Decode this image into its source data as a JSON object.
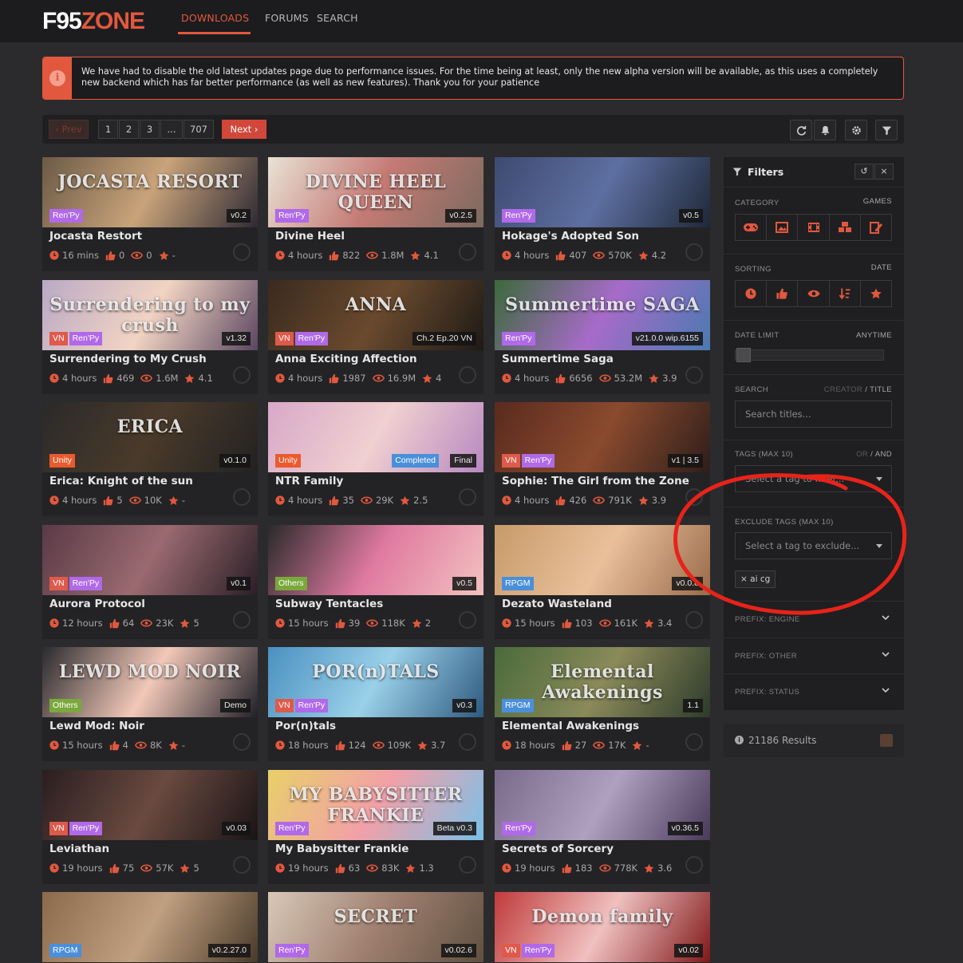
{
  "nav": {
    "logo_a": "F95",
    "logo_b": "ZONE",
    "items": [
      "DOWNLOADS",
      "FORUMS",
      "SEARCH"
    ]
  },
  "notice": {
    "icon": "info-icon",
    "text": "We have had to disable the old latest updates page due to performance issues. For the time being at least, only the new alpha version will be available, as this uses a completely new backend which has far better performance (as well as new features). Thank you for your patience"
  },
  "pager": {
    "prev": "‹ Prev",
    "pages": [
      "1",
      "2",
      "3",
      "...",
      "707"
    ],
    "next": "Next ›"
  },
  "cards": [
    {
      "title": "Jocasta Restort",
      "thumb_text": "JOCASTA RESORT",
      "badges": [
        "Ren'Py"
      ],
      "version": "v0.2",
      "time": "16 mins",
      "likes": "0",
      "views": "0",
      "rating": "-"
    },
    {
      "title": "Divine Heel",
      "thumb_text": "DIVINE HEEL QUEEN",
      "badges": [
        "Ren'Py"
      ],
      "version": "v0.2.5",
      "time": "4 hours",
      "likes": "822",
      "views": "1.8M",
      "rating": "4.1"
    },
    {
      "title": "Hokage's Adopted Son",
      "thumb_text": "",
      "badges": [
        "Ren'Py"
      ],
      "version": "v0.5",
      "time": "4 hours",
      "likes": "407",
      "views": "570K",
      "rating": "4.2"
    },
    {
      "title": "Surrendering to My Crush",
      "thumb_text": "Surrendering to my crush",
      "badges": [
        "VN",
        "Ren'Py"
      ],
      "version": "v1.32",
      "time": "4 hours",
      "likes": "469",
      "views": "1.6M",
      "rating": "4.1"
    },
    {
      "title": "Anna Exciting Affection",
      "thumb_text": "ANNA",
      "badges": [
        "VN",
        "Ren'Py"
      ],
      "version": "Ch.2 Ep.20 VN",
      "time": "4 hours",
      "likes": "1987",
      "views": "16.9M",
      "rating": "4"
    },
    {
      "title": "Summertime Saga",
      "thumb_text": "Summertime SAGA",
      "badges": [
        "Ren'Py"
      ],
      "version": "v21.0.0 wip.6155",
      "time": "4 hours",
      "likes": "6656",
      "views": "53.2M",
      "rating": "3.9"
    },
    {
      "title": "Erica: Knight of the sun",
      "thumb_text": "ERICA",
      "badges": [
        "Unity"
      ],
      "version": "v0.1.0",
      "time": "4 hours",
      "likes": "5",
      "views": "10K",
      "rating": "-"
    },
    {
      "title": "NTR Family",
      "thumb_text": "",
      "badges": [
        "Unity"
      ],
      "status": "Completed",
      "version": "Final",
      "time": "4 hours",
      "likes": "35",
      "views": "29K",
      "rating": "2.5"
    },
    {
      "title": "Sophie: The Girl from the Zone",
      "thumb_text": "",
      "badges": [
        "VN",
        "Ren'Py"
      ],
      "version": "v1 | 3.5",
      "time": "4 hours",
      "likes": "426",
      "views": "791K",
      "rating": "3.9"
    },
    {
      "title": "Aurora Protocol",
      "thumb_text": "",
      "badges": [
        "VN",
        "Ren'Py"
      ],
      "version": "v0.1",
      "time": "12 hours",
      "likes": "64",
      "views": "23K",
      "rating": "5"
    },
    {
      "title": "Subway Tentacles",
      "thumb_text": "",
      "badges": [
        "Others"
      ],
      "version": "v0.5",
      "time": "15 hours",
      "likes": "39",
      "views": "118K",
      "rating": "2"
    },
    {
      "title": "Dezato Wasteland",
      "thumb_text": "",
      "badges": [
        "RPGM"
      ],
      "version": "v0.0.8",
      "time": "15 hours",
      "likes": "103",
      "views": "161K",
      "rating": "3.4"
    },
    {
      "title": "Lewd Mod: Noir",
      "thumb_text": "LEWD MOD NOIR",
      "badges": [
        "Others"
      ],
      "version": "Demo",
      "time": "15 hours",
      "likes": "4",
      "views": "8K",
      "rating": "-"
    },
    {
      "title": "Por(n)tals",
      "thumb_text": "POR(n)TALS",
      "badges": [
        "VN",
        "Ren'Py"
      ],
      "version": "v0.3",
      "time": "18 hours",
      "likes": "124",
      "views": "109K",
      "rating": "3.7"
    },
    {
      "title": "Elemental Awakenings",
      "thumb_text": "Elemental Awakenings",
      "badges": [
        "RPGM"
      ],
      "version": "1.1",
      "time": "18 hours",
      "likes": "27",
      "views": "17K",
      "rating": "-"
    },
    {
      "title": "Leviathan",
      "thumb_text": "",
      "badges": [
        "VN",
        "Ren'Py"
      ],
      "version": "v0.03",
      "time": "19 hours",
      "likes": "75",
      "views": "57K",
      "rating": "5"
    },
    {
      "title": "My Babysitter Frankie",
      "thumb_text": "MY BABYSITTER FRANKIE",
      "badges": [
        "Ren'Py"
      ],
      "version": "Beta v0.3",
      "time": "19 hours",
      "likes": "63",
      "views": "83K",
      "rating": "1.3"
    },
    {
      "title": "Secrets of Sorcery",
      "thumb_text": "",
      "badges": [
        "Ren'Py"
      ],
      "version": "v0.36.5",
      "time": "19 hours",
      "likes": "183",
      "views": "778K",
      "rating": "3.6"
    },
    {
      "title": "",
      "thumb_text": "",
      "badges": [
        "RPGM"
      ],
      "version": "v0.2.27.0",
      "time": "",
      "likes": "",
      "views": "",
      "rating": ""
    },
    {
      "title": "",
      "thumb_text": "SECRET",
      "badges": [
        "Ren'Py"
      ],
      "version": "v0.02.6",
      "time": "",
      "likes": "",
      "views": "",
      "rating": ""
    },
    {
      "title": "",
      "thumb_text": "Demon family",
      "badges": [
        "VN",
        "Ren'Py"
      ],
      "version": "v0.02",
      "time": "",
      "likes": "",
      "views": "",
      "rating": ""
    }
  ],
  "filters": {
    "title": "Filters",
    "category_label": "CATEGORY",
    "category_value": "GAMES",
    "sorting_label": "SORTING",
    "sorting_value": "DATE",
    "date_limit_label": "DATE LIMIT",
    "date_limit_value": "ANYTIME",
    "search_label": "SEARCH",
    "search_mode_a": "CREATOR",
    "search_mode_b": "TITLE",
    "search_placeholder": "Search titles...",
    "tags_label": "TAGS (MAX 10)",
    "tags_mode_a": "OR",
    "tags_mode_b": "AND",
    "tags_placeholder": "Select a tag to filter...",
    "exclude_label": "EXCLUDE TAGS (MAX 10)",
    "exclude_placeholder": "Select a tag to exclude...",
    "exclude_chip": "× ai cg",
    "prefix_engine": "PREFIX: ENGINE",
    "prefix_other": "PREFIX: OTHER",
    "prefix_status": "PREFIX: STATUS"
  },
  "results": {
    "text": "21186 Results"
  },
  "colors": {
    "accent": "#e2583e",
    "renpy": "#b069e8",
    "vn": "#de5a4a",
    "unity": "#ea5a2e",
    "others": "#7aa83c",
    "rpgm": "#4a8fda",
    "annotation": "#e8231a"
  }
}
